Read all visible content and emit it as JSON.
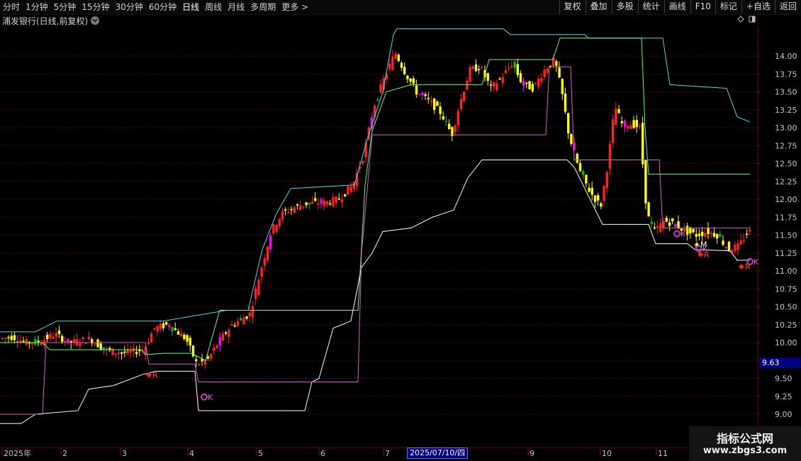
{
  "toolbar": {
    "period_tabs": [
      {
        "label": "分时"
      },
      {
        "label": "1分钟"
      },
      {
        "label": "5分钟"
      },
      {
        "label": "15分钟"
      },
      {
        "label": "30分钟"
      },
      {
        "label": "60分钟"
      },
      {
        "label": "日线",
        "active": true
      },
      {
        "label": "周线"
      },
      {
        "label": "月线"
      },
      {
        "label": "多周期"
      },
      {
        "label": "更多 >"
      }
    ],
    "buttons": [
      "复权",
      "叠加",
      "多股",
      "统计",
      "画线",
      "F10",
      "标记",
      "+自选",
      "返回"
    ]
  },
  "chart_title": "浦发银行(日线,前复权)",
  "cursor": {
    "price_label": "9.63",
    "date_label": "2025/07/10/四"
  },
  "watermark": {
    "title": "指标公式网",
    "url": "www.zbgs3.com"
  },
  "colors": {
    "up_candle": "#ff2020",
    "down_candle": "#ffff00",
    "accent_magenta": "#ff00ff",
    "accent_green": "#00c000",
    "upper_channel": "#40e0e0",
    "mid_line": "#60ff60",
    "lower_channel": "#ffffff",
    "stop_line": "#d060d0",
    "grid": "#6a0000"
  },
  "chart_data": {
    "type": "candlestick",
    "ylim": [
      8.8,
      14.5
    ],
    "y_ticks": [
      "14.00",
      "13.75",
      "13.50",
      "13.25",
      "13.00",
      "12.75",
      "12.50",
      "12.25",
      "12.00",
      "11.75",
      "11.50",
      "11.25",
      "11.00",
      "10.75",
      "10.50",
      "10.25",
      "10.00",
      "9.75",
      "9.50",
      "9.25",
      "9.00"
    ],
    "x_ticks": [
      "2025年",
      "2",
      "3",
      "4",
      "5",
      "6",
      "7",
      "9",
      "10",
      "11"
    ],
    "signals": [
      {
        "label": "R",
        "type": "diamond",
        "color": "#ff2020"
      },
      {
        "label": "K",
        "type": "circle",
        "color": "#c040c0"
      },
      {
        "label": "K",
        "type": "circle",
        "color": "#c040c0"
      },
      {
        "label": "M",
        "type": "star",
        "color": "#ffff60"
      },
      {
        "label": "K",
        "type": "circle",
        "color": "#c040c0"
      },
      {
        "label": "R",
        "type": "diamond",
        "color": "#ff2020"
      },
      {
        "label": "K",
        "type": "circle",
        "color": "#c040c0"
      },
      {
        "label": "R",
        "type": "diamond",
        "color": "#ff2020"
      }
    ]
  }
}
